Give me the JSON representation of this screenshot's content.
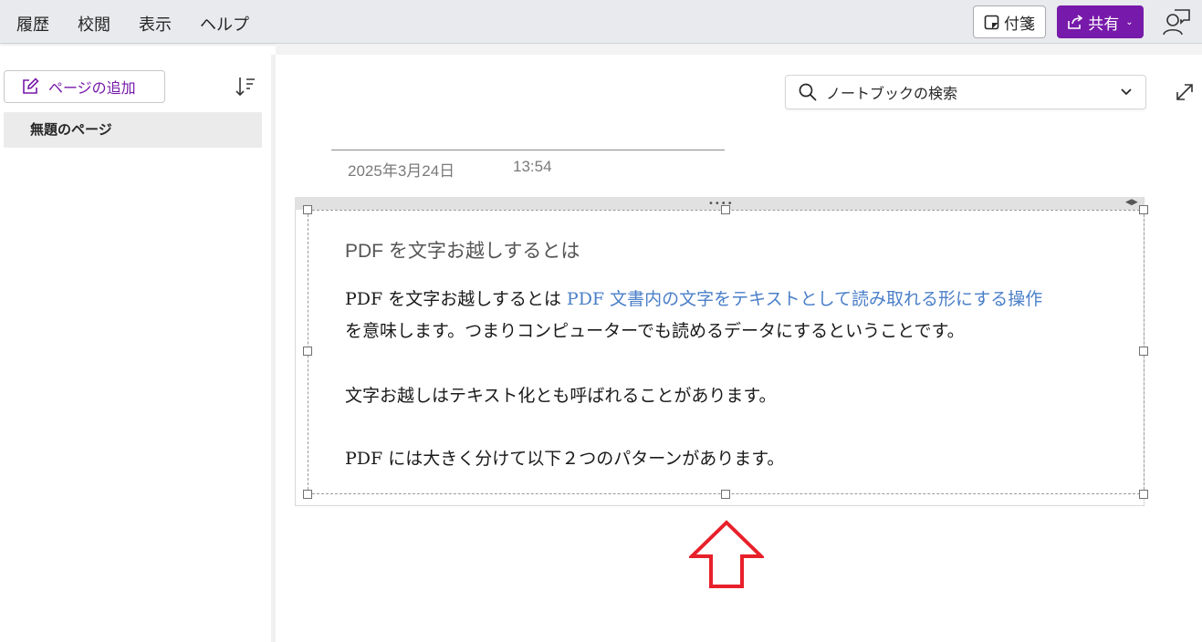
{
  "ribbon": {
    "menu": [
      "履歴",
      "校閲",
      "表示",
      "ヘルプ"
    ],
    "sticky_label": "付箋",
    "share_label": "共有"
  },
  "sidebar": {
    "add_page_label": "ページの追加",
    "pages": [
      "無題のページ"
    ]
  },
  "search": {
    "placeholder": "ノートブックの検索"
  },
  "page": {
    "date": "2025年3月24日",
    "time": "13:54"
  },
  "note": {
    "heading": "PDF を文字お越しするとは",
    "para1_plain": "PDF を文字お越しするとは ",
    "para1_link": "PDF 文書内の文字をテキストとして読み取れる形にする操作",
    "para1_line2": "を意味します。つまりコンピューターでも読めるデータにするということです。",
    "para2": "文字お越しはテキスト化とも呼ばれることがあります。",
    "para3": "PDF には大きく分けて以下２つのパターンがあります。"
  },
  "colors": {
    "accent": "#7719aa",
    "link": "#4a7fc8",
    "annotation_arrow": "#e8202a"
  }
}
